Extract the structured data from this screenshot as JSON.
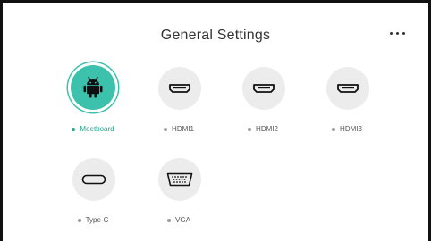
{
  "header": {
    "title": "General Settings"
  },
  "sources": [
    {
      "label": "Meetboard",
      "icon": "android-icon",
      "active": true
    },
    {
      "label": "HDMI1",
      "icon": "hdmi-port-icon",
      "active": false
    },
    {
      "label": "HDMI2",
      "icon": "hdmi-port-icon",
      "active": false
    },
    {
      "label": "HDMI3",
      "icon": "hdmi-port-icon",
      "active": false
    },
    {
      "label": "Type-C",
      "icon": "usb-c-port-icon",
      "active": false
    },
    {
      "label": "VGA",
      "icon": "vga-port-icon",
      "active": false
    }
  ],
  "colors": {
    "accent": "#3cc2ac",
    "active_label": "#22a88f",
    "icon_circle": "#ececec"
  }
}
